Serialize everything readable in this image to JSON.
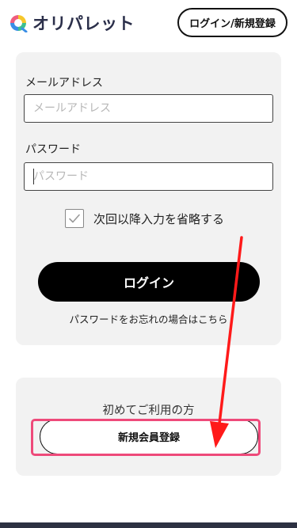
{
  "header": {
    "logo_text": "オリパレット",
    "login_register_label": "ログイン/新規登録"
  },
  "login_form": {
    "email_label": "メールアドレス",
    "email_placeholder": "メールアドレス",
    "email_value": "",
    "password_label": "パスワード",
    "password_placeholder": "パスワード",
    "password_value": "",
    "remember_label": "次回以降入力を省略する",
    "remember_checked": true,
    "submit_label": "ログイン",
    "forgot_link": "パスワードをお忘れの場合はこちら"
  },
  "signup": {
    "prompt": "初めてご利用の方",
    "button_label": "新規会員登録"
  },
  "annotation": {
    "highlight_color": "#ee4a7a",
    "arrow_color": "#ff1a1a"
  }
}
